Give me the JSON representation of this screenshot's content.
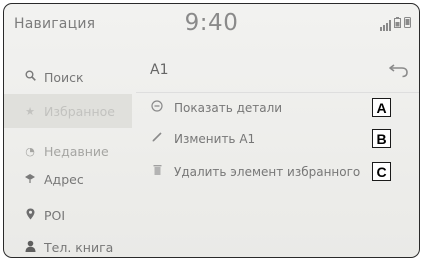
{
  "status": {
    "app_title": "Навигация",
    "clock": "9:40",
    "icons": [
      "signal-icon",
      "battery-icon",
      "phone-icon"
    ]
  },
  "sidebar": {
    "items": [
      {
        "label": "Поиск",
        "icon": "search-icon",
        "state": "normal"
      },
      {
        "label": "Избранное",
        "icon": "star-icon",
        "state": "active"
      },
      {
        "label": "Недавние",
        "icon": "recent-icon",
        "state": "faded"
      },
      {
        "label": "Адрес",
        "icon": "address-icon",
        "state": "normal"
      },
      {
        "label": "POI",
        "icon": "poi-icon",
        "state": "normal"
      },
      {
        "label": "Тел. книга",
        "icon": "contact-icon",
        "state": "normal"
      }
    ]
  },
  "main": {
    "title": "A1",
    "back_icon": "back-arrow-icon",
    "menu": [
      {
        "label": "Показать детали",
        "icon": "details-icon",
        "callout": "A"
      },
      {
        "label": "Изменить A1",
        "icon": "edit-icon",
        "callout": "B"
      },
      {
        "label": "Удалить элемент избранного",
        "icon": "delete-icon",
        "callout": "C"
      }
    ]
  }
}
